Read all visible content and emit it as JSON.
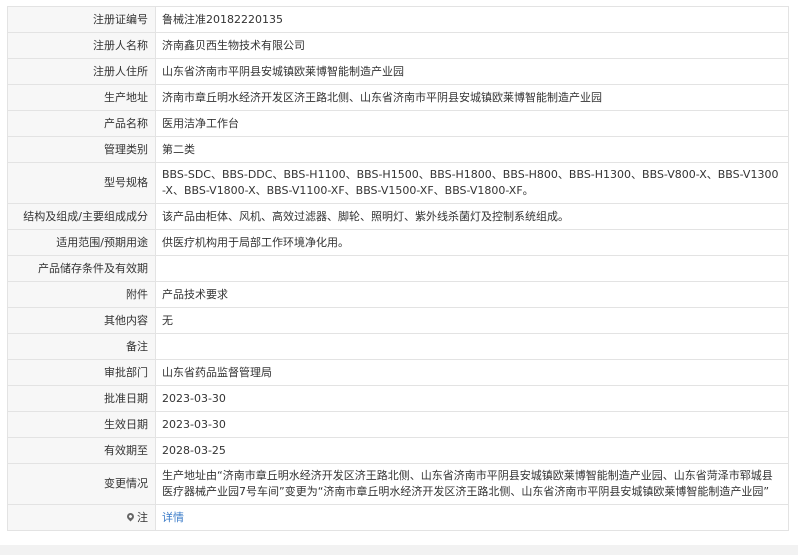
{
  "registration": {
    "cert_no_label": "注册证编号",
    "cert_no": "鲁械注准20182220135",
    "registrant_name_label": "注册人名称",
    "registrant_name": "济南鑫贝西生物技术有限公司",
    "registrant_address_label": "注册人住所",
    "registrant_address": "山东省济南市平阴县安城镇欧莱博智能制造产业园",
    "production_address_label": "生产地址",
    "production_address": "济南市章丘明水经济开发区济王路北侧、山东省济南市平阴县安城镇欧莱博智能制造产业园",
    "product_name_label": "产品名称",
    "product_name": "医用洁净工作台",
    "category_label": "管理类别",
    "category": "第二类",
    "model_label": "型号规格",
    "model": "BBS-SDC、BBS-DDC、BBS-H1100、BBS-H1500、BBS-H1800、BBS-H800、BBS-H1300、BBS-V800-X、BBS-V1300-X、BBS-V1800-X、BBS-V1100-XF、BBS-V1500-XF、BBS-V1800-XF。",
    "structure_label": "结构及组成/主要组成成分",
    "structure": "该产品由柜体、风机、高效过滤器、脚轮、照明灯、紫外线杀菌灯及控制系统组成。",
    "scope_label": "适用范围/预期用途",
    "scope": "供医疗机构用于局部工作环境净化用。",
    "storage_label": "产品储存条件及有效期",
    "storage": "",
    "attachment_label": "附件",
    "attachment": "产品技术要求",
    "other_label": "其他内容",
    "other": "无",
    "remarks_label": "备注",
    "remarks": "",
    "approval_dept_label": "审批部门",
    "approval_dept": "山东省药品监督管理局",
    "approval_date_label": "批准日期",
    "approval_date": "2023-03-30",
    "effective_date_label": "生效日期",
    "effective_date": "2023-03-30",
    "expiry_date_label": "有效期至",
    "expiry_date": "2028-03-25",
    "changes_label": "变更情况",
    "changes": "生产地址由“济南市章丘明水经济开发区济王路北侧、山东省济南市平阴县安城镇欧莱博智能制造产业园、山东省菏泽市郓城县医疗器械产业园7号车间”变更为“济南市章丘明水经济开发区济王路北侧、山东省济南市平阴县安城镇欧莱博智能制造产业园”",
    "note_label": "注",
    "note_link": "详情"
  },
  "colors": {
    "label_bg": "#f7f7f7",
    "border": "#e3e3e3",
    "link": "#3a7bc8",
    "text": "#333333"
  },
  "icons": {
    "note": "map-pin-icon"
  }
}
